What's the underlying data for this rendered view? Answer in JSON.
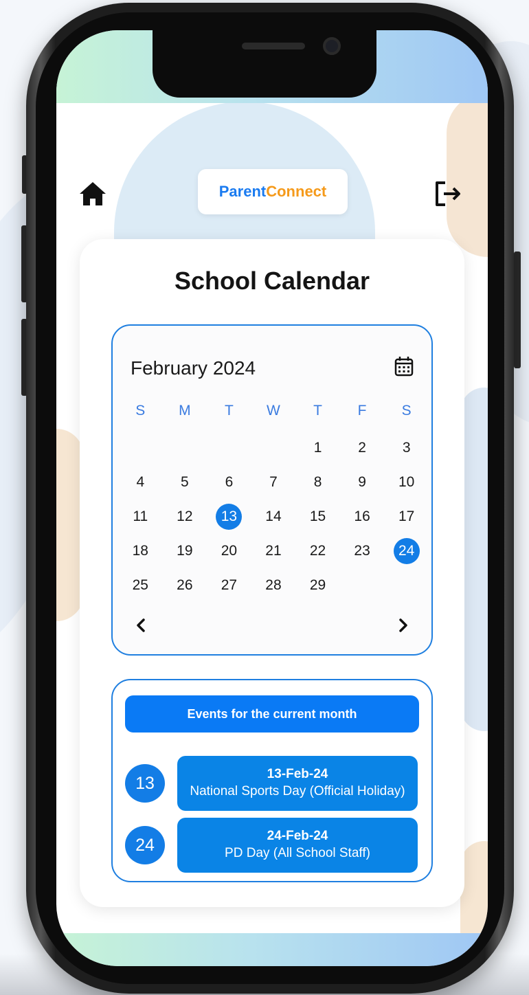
{
  "brand": {
    "part1": "Parent",
    "part2": "Connect"
  },
  "page_title": "School Calendar",
  "calendar": {
    "month_label": "February 2024",
    "weekdays": [
      "S",
      "M",
      "T",
      "W",
      "T",
      "F",
      "S"
    ],
    "weeks": [
      [
        "",
        "",
        "",
        "",
        "1",
        "2",
        "3"
      ],
      [
        "4",
        "5",
        "6",
        "7",
        "8",
        "9",
        "10"
      ],
      [
        "11",
        "12",
        "13",
        "14",
        "15",
        "16",
        "17"
      ],
      [
        "18",
        "19",
        "20",
        "21",
        "22",
        "23",
        "24"
      ],
      [
        "25",
        "26",
        "27",
        "28",
        "29",
        "",
        ""
      ]
    ],
    "selected_days": [
      "13",
      "24"
    ]
  },
  "events": {
    "header": "Events for the current month",
    "items": [
      {
        "day": "13",
        "date": "13-Feb-24",
        "title": "National Sports Day (Official Holiday)"
      },
      {
        "day": "24",
        "date": "24-Feb-24",
        "title": "PD Day (All School Staff)"
      }
    ]
  },
  "icons": {
    "home": "home-icon",
    "logout": "logout-icon",
    "calendar": "calendar-icon",
    "prev": "chevron-left-icon",
    "next": "chevron-right-icon"
  },
  "colors": {
    "primary": "#137de6",
    "brand_blue": "#1a7bf0",
    "brand_orange": "#f59a1b"
  }
}
